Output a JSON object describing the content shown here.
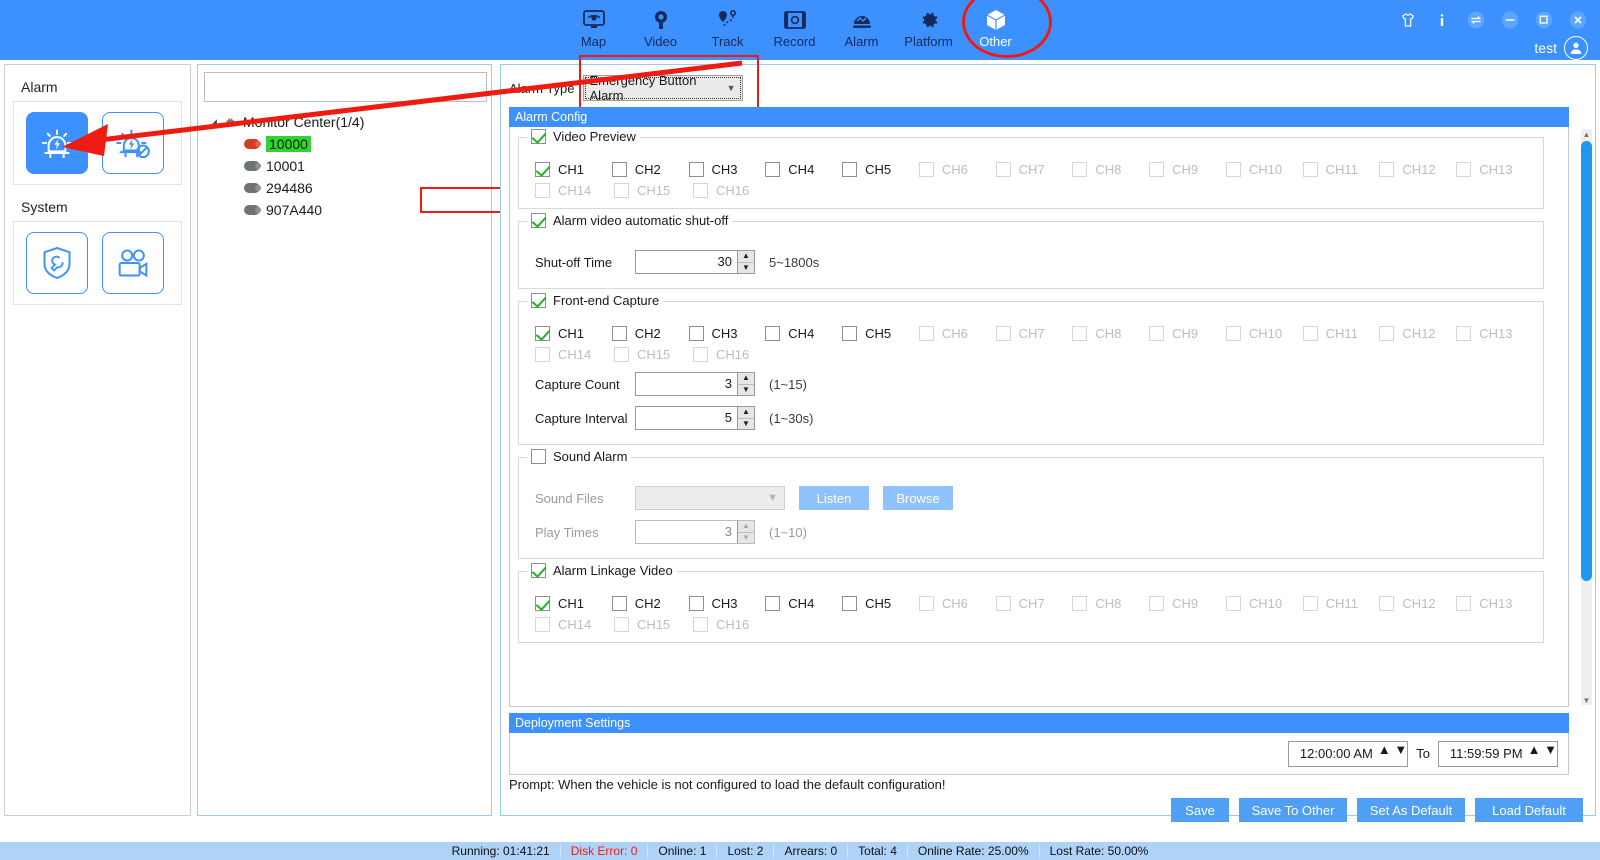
{
  "topbar": {
    "nav": [
      {
        "label": "Map",
        "icon": "map-monitor-icon",
        "active": false
      },
      {
        "label": "Video",
        "icon": "video-camera-icon",
        "active": false
      },
      {
        "label": "Track",
        "icon": "track-pin-icon",
        "active": false
      },
      {
        "label": "Record",
        "icon": "record-film-icon",
        "active": false
      },
      {
        "label": "Alarm",
        "icon": "alarm-bell-icon",
        "active": false
      },
      {
        "label": "Platform",
        "icon": "gear-icon",
        "active": false
      },
      {
        "label": "Other",
        "icon": "cube-box-icon",
        "active": true
      }
    ],
    "window_buttons": [
      {
        "name": "shirt-skin-icon",
        "glyph": "\u0001"
      },
      {
        "name": "info-icon",
        "glyph": "i"
      },
      {
        "name": "switch-account-icon",
        "glyph": "⇌"
      },
      {
        "name": "minimize-icon",
        "glyph": "−"
      },
      {
        "name": "maximize-icon",
        "glyph": "❐"
      },
      {
        "name": "close-icon",
        "glyph": "✕"
      }
    ],
    "user": "test",
    "accent": "#3d91ff",
    "highlight_color": "#ee1b12"
  },
  "left_panel": {
    "groups": [
      {
        "title": "Alarm",
        "buttons": [
          {
            "name": "alarm-on-button",
            "icon": "alarm-light-icon",
            "selected": true
          },
          {
            "name": "alarm-off-button",
            "icon": "alarm-light-disabled-icon",
            "selected": false
          }
        ]
      },
      {
        "title": "System",
        "buttons": [
          {
            "name": "system-maintenance-button",
            "icon": "shield-wrench-icon",
            "selected": false
          },
          {
            "name": "system-camera-button",
            "icon": "dual-camera-icon",
            "selected": false
          }
        ]
      }
    ]
  },
  "tree_panel": {
    "search_value": "",
    "search_placeholder": "",
    "root": {
      "label": "Monitor Center(1/4)",
      "expanded": true,
      "twisty": "◢"
    },
    "devices": [
      {
        "label": "10000",
        "online": true,
        "selected": true,
        "highlighted": true
      },
      {
        "label": "10001",
        "online": false,
        "selected": false,
        "highlighted": false
      },
      {
        "label": "294486",
        "online": false,
        "selected": false,
        "highlighted": false
      },
      {
        "label": "907A440",
        "online": false,
        "selected": false,
        "highlighted": false
      }
    ]
  },
  "config": {
    "alarm_type_label": "Alarm Type",
    "alarm_type_value": "Emergency Button Alarm",
    "alarm_config_header": "Alarm Config",
    "deployment_header": "Deployment Settings",
    "channels_row1": [
      "CH1",
      "CH2",
      "CH3",
      "CH4",
      "CH5",
      "CH6",
      "CH7",
      "CH8",
      "CH9",
      "CH10",
      "CH11",
      "CH12",
      "CH13"
    ],
    "channels_row2": [
      "CH14",
      "CH15",
      "CH16"
    ],
    "enabled_channel_count": 5,
    "sections": [
      {
        "name": "video-preview",
        "title": "Video Preview",
        "checked": true,
        "enabled": true,
        "checked_channels": [
          "CH1"
        ]
      },
      {
        "name": "alarm-video-auto-shutoff",
        "title": "Alarm video automatic shut-off",
        "checked": true,
        "enabled": true,
        "fields": [
          {
            "label": "Shut-off Time",
            "value": "30",
            "hint": "5~1800s"
          }
        ]
      },
      {
        "name": "front-end-capture",
        "title": "Front-end Capture",
        "checked": true,
        "enabled": true,
        "checked_channels": [
          "CH1"
        ],
        "fields": [
          {
            "label": "Capture Count",
            "value": "3",
            "hint": "(1~15)"
          },
          {
            "label": "Capture Interval",
            "value": "5",
            "hint": "(1~30s)"
          }
        ]
      },
      {
        "name": "sound-alarm",
        "title": "Sound Alarm",
        "checked": false,
        "enabled": false,
        "sound_files_label": "Sound Files",
        "sound_files_value": "",
        "listen_label": "Listen",
        "browse_label": "Browse",
        "fields": [
          {
            "label": "Play Times",
            "value": "3",
            "hint": "(1~10)"
          }
        ]
      },
      {
        "name": "alarm-linkage-video",
        "title": "Alarm Linkage Video",
        "checked": true,
        "enabled": true,
        "checked_channels": [
          "CH1"
        ]
      }
    ],
    "deployment": {
      "start_time": "12:00:00 AM",
      "to_label": "To",
      "end_time": "11:59:59 PM"
    },
    "prompt": "Prompt:  When the vehicle is not configured to load the default configuration!",
    "buttons": [
      {
        "name": "save-button",
        "label": "Save",
        "wide": false
      },
      {
        "name": "save-to-other-button",
        "label": "Save To Other",
        "wide": true
      },
      {
        "name": "set-as-default-button",
        "label": "Set As Default",
        "wide": true
      },
      {
        "name": "load-default-button",
        "label": "Load Default",
        "wide": true
      }
    ]
  },
  "status_bar": [
    {
      "name": "running-time",
      "text": "Running: 01:41:21",
      "error": false
    },
    {
      "name": "disk-error",
      "text": "Disk Error: 0",
      "error": true
    },
    {
      "name": "online-count",
      "text": "Online: 1",
      "error": false
    },
    {
      "name": "lost-count",
      "text": "Lost: 2",
      "error": false
    },
    {
      "name": "arrears-count",
      "text": "Arrears: 0",
      "error": false
    },
    {
      "name": "total-count",
      "text": "Total: 4",
      "error": false
    },
    {
      "name": "online-rate",
      "text": "Online Rate: 25.00%",
      "error": false
    },
    {
      "name": "lost-rate",
      "text": "Lost Rate: 50.00%",
      "error": false
    }
  ]
}
